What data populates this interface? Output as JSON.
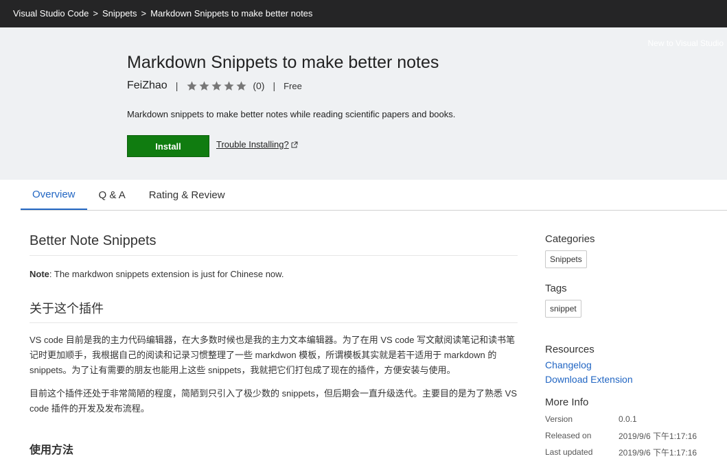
{
  "breadcrumb": {
    "items": [
      "Visual Studio Code",
      "Snippets",
      "Markdown Snippets to make better notes"
    ],
    "separator": ">"
  },
  "hero": {
    "new_to_text": "New to Visual Studio",
    "title": "Markdown Snippets to make better notes",
    "publisher": "FeiZhao",
    "rating_stars": 0,
    "rating_max": 5,
    "rating_count": "(0)",
    "price": "Free",
    "description": "Markdown snippets to make better notes while reading scientific papers and books.",
    "install_label": "Install",
    "trouble_label": "Trouble Installing?"
  },
  "tabs": [
    {
      "label": "Overview",
      "active": true
    },
    {
      "label": "Q & A",
      "active": false
    },
    {
      "label": "Rating & Review",
      "active": false
    }
  ],
  "content": {
    "heading": "Better Note Snippets",
    "note_label": "Note",
    "note_text": ": The markdwon snippets extension is just for Chinese now.",
    "section_heading": "关于这个插件",
    "paragraph1": "VS code 目前是我的主力代码编辑器，在大多数时候也是我的主力文本编辑器。为了在用 VS code 写文献阅读笔记和读书笔记时更加顺手，我根据自己的阅读和记录习惯整理了一些 markdwon 模板，所谓模板其实就是若干适用于 markdown 的 snippets。为了让有需要的朋友也能用上这些 snippets，我就把它们打包成了现在的插件，方便安装与使用。",
    "paragraph2": "目前这个插件还处于非常简陋的程度，简陋到只引入了极少数的 snippets，但后期会一直升级迭代。主要目的是为了熟悉 VS code 插件的开发及发布流程。",
    "next_heading": "使用方法"
  },
  "sidebar": {
    "categories_title": "Categories",
    "categories": [
      "Snippets"
    ],
    "tags_title": "Tags",
    "tags": [
      "snippet"
    ],
    "resources_title": "Resources",
    "resources": [
      "Changelog",
      "Download Extension"
    ],
    "more_info_title": "More Info",
    "more_info": [
      {
        "key": "Version",
        "value": "0.0.1"
      },
      {
        "key": "Released on",
        "value": "2019/9/6 下午1:17:16"
      },
      {
        "key": "Last updated",
        "value": "2019/9/6 下午1:17:16"
      }
    ]
  },
  "colors": {
    "topbar": "#252526",
    "hero_bg": "#eff1f3",
    "install": "#107c10",
    "accent": "#2266c3"
  }
}
